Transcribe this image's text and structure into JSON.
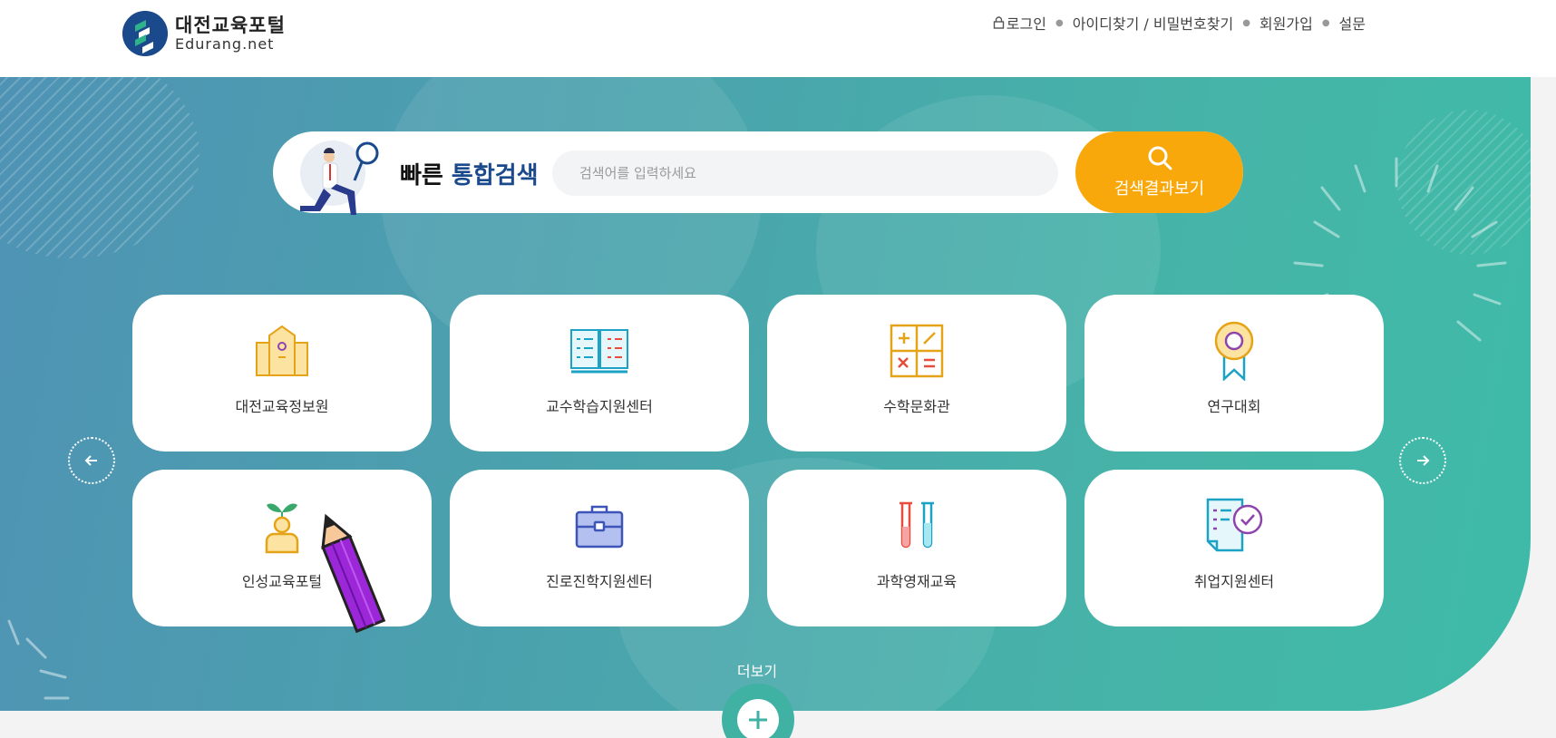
{
  "header": {
    "logo_title": "대전교육포털",
    "logo_sub": "Edurang.net",
    "nav": {
      "login": "로그인",
      "find_id_pw": "아이디찾기 / 비밀번호찾기",
      "signup": "회원가입",
      "survey": "설문"
    }
  },
  "search": {
    "title_prefix": "빠른",
    "title_highlight": "통합검색",
    "placeholder": "검색어를 입력하세요",
    "button_label": "검색결과보기"
  },
  "cards": [
    {
      "label": "대전교육정보원",
      "icon": "building-icon"
    },
    {
      "label": "교수학습지원센터",
      "icon": "open-book-icon"
    },
    {
      "label": "수학문화관",
      "icon": "calculator-icon"
    },
    {
      "label": "연구대회",
      "icon": "award-ribbon-icon"
    },
    {
      "label": "인성교육포털",
      "icon": "person-sprout-icon"
    },
    {
      "label": "진로진학지원센터",
      "icon": "briefcase-icon"
    },
    {
      "label": "과학영재교육",
      "icon": "test-tubes-icon"
    },
    {
      "label": "취업지원센터",
      "icon": "document-check-icon"
    }
  ],
  "more_label": "더보기",
  "colors": {
    "brand_blue": "#1b4a8c",
    "accent_orange": "#f9a80c",
    "hero_teal": "#46b4a8"
  }
}
